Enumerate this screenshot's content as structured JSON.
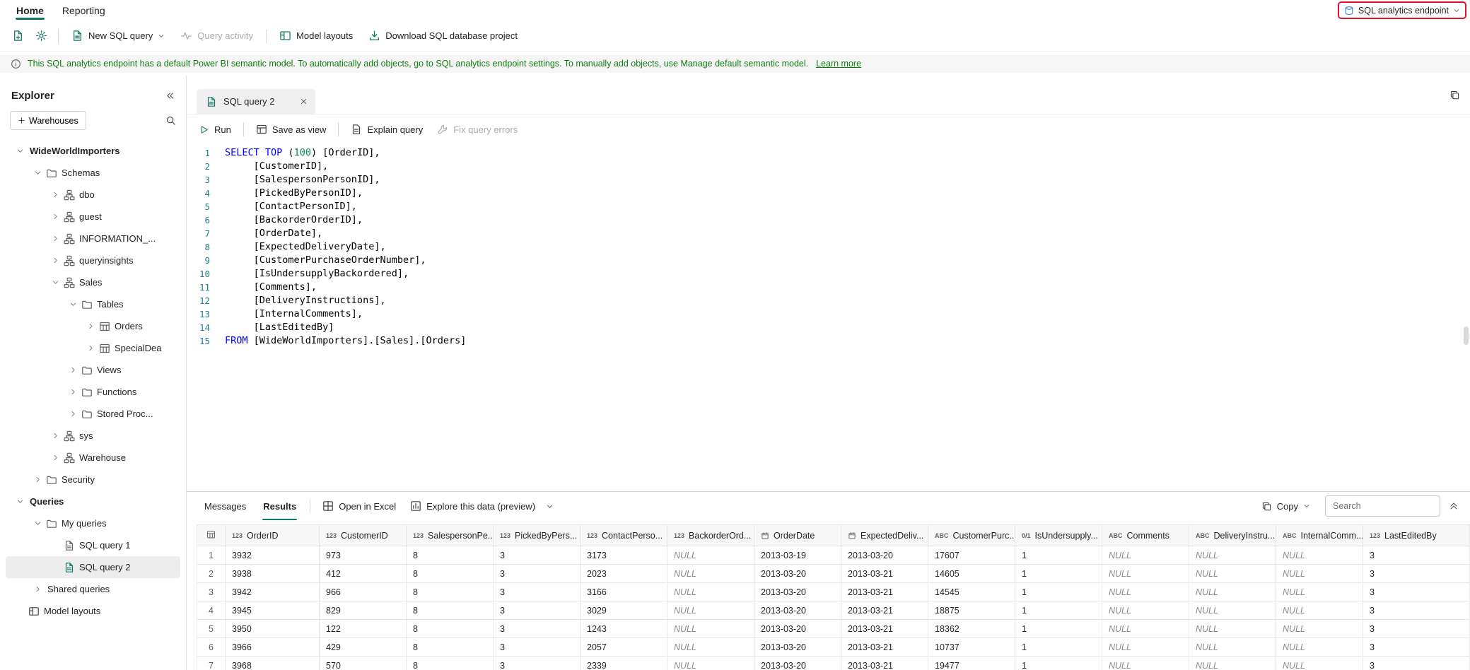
{
  "accent_color": "#117865",
  "highlight_color": "#e8112d",
  "ribbon": {
    "tabs": [
      {
        "label": "Home"
      },
      {
        "label": "Reporting"
      }
    ],
    "endpoint": {
      "label": "SQL analytics endpoint"
    }
  },
  "toolbar": {
    "new_sql_query": "New SQL query",
    "query_activity": "Query activity",
    "model_layouts": "Model layouts",
    "download_project": "Download SQL database project"
  },
  "banner": {
    "text": "This SQL analytics endpoint has a default Power BI semantic model. To automatically add objects, go to SQL analytics endpoint settings. To manually add objects, use Manage default semantic model.",
    "link": "Learn more"
  },
  "explorer": {
    "title": "Explorer",
    "warehouses": "Warehouses",
    "tree": [
      {
        "label": "WideWorldImporters",
        "level": 0,
        "chevron": "down",
        "icon": null,
        "bold": true
      },
      {
        "label": "Schemas",
        "level": 1,
        "chevron": "down",
        "icon": "folder"
      },
      {
        "label": "dbo",
        "level": 2,
        "chevron": "right",
        "icon": "schema"
      },
      {
        "label": "guest",
        "level": 2,
        "chevron": "right",
        "icon": "schema"
      },
      {
        "label": "INFORMATION_...",
        "level": 2,
        "chevron": "right",
        "icon": "schema"
      },
      {
        "label": "queryinsights",
        "level": 2,
        "chevron": "right",
        "icon": "schema"
      },
      {
        "label": "Sales",
        "level": 2,
        "chevron": "down",
        "icon": "schema"
      },
      {
        "label": "Tables",
        "level": 3,
        "chevron": "down",
        "icon": "folder"
      },
      {
        "label": "Orders",
        "level": 4,
        "chevron": "right",
        "icon": "table"
      },
      {
        "label": "SpecialDea",
        "level": 4,
        "chevron": "right",
        "icon": "table"
      },
      {
        "label": "Views",
        "level": 3,
        "chevron": "right",
        "icon": "folder"
      },
      {
        "label": "Functions",
        "level": 3,
        "chevron": "right",
        "icon": "folder"
      },
      {
        "label": "Stored Proc...",
        "level": 3,
        "chevron": "right",
        "icon": "folder"
      },
      {
        "label": "sys",
        "level": 2,
        "chevron": "right",
        "icon": "schema"
      },
      {
        "label": "Warehouse",
        "level": 2,
        "chevron": "right",
        "icon": "schema"
      },
      {
        "label": "Security",
        "level": 1,
        "chevron": "right",
        "icon": "folder"
      },
      {
        "label": "Queries",
        "level": 0,
        "chevron": "down",
        "icon": null,
        "bold": true
      },
      {
        "label": "My queries",
        "level": 1,
        "chevron": "down",
        "icon": "folder"
      },
      {
        "label": "SQL query 1",
        "level": 2,
        "chevron": null,
        "icon": "sql"
      },
      {
        "label": "SQL query 2",
        "level": 2,
        "chevron": null,
        "icon": "sql-active",
        "selected": true
      },
      {
        "label": "Shared queries",
        "level": 1,
        "chevron": "right",
        "icon": null
      },
      {
        "label": "Model layouts",
        "level": 0,
        "chevron": null,
        "icon": "model"
      }
    ]
  },
  "tab": {
    "title": "SQL query 2"
  },
  "query_toolbar": {
    "run": "Run",
    "save_as_view": "Save as view",
    "explain_query": "Explain query",
    "fix_query_errors": "Fix query errors"
  },
  "editor": {
    "lines": [
      [
        [
          "kw",
          "SELECT"
        ],
        [
          "pl",
          " "
        ],
        [
          "kw",
          "TOP"
        ],
        [
          "pl",
          " ("
        ],
        [
          "num",
          "100"
        ],
        [
          "pl",
          ") [OrderID],"
        ]
      ],
      [
        [
          "pl",
          "     [CustomerID],"
        ]
      ],
      [
        [
          "pl",
          "     [SalespersonPersonID],"
        ]
      ],
      [
        [
          "pl",
          "     [PickedByPersonID],"
        ]
      ],
      [
        [
          "pl",
          "     [ContactPersonID],"
        ]
      ],
      [
        [
          "pl",
          "     [BackorderOrderID],"
        ]
      ],
      [
        [
          "pl",
          "     [OrderDate],"
        ]
      ],
      [
        [
          "pl",
          "     [ExpectedDeliveryDate],"
        ]
      ],
      [
        [
          "pl",
          "     [CustomerPurchaseOrderNumber],"
        ]
      ],
      [
        [
          "pl",
          "     [IsUndersupplyBackordered],"
        ]
      ],
      [
        [
          "pl",
          "     [Comments],"
        ]
      ],
      [
        [
          "pl",
          "     [DeliveryInstructions],"
        ]
      ],
      [
        [
          "pl",
          "     [InternalComments],"
        ]
      ],
      [
        [
          "pl",
          "     [LastEditedBy]"
        ]
      ],
      [
        [
          "kw",
          "FROM"
        ],
        [
          "pl",
          " [WideWorldImporters].[Sales].[Orders]"
        ]
      ]
    ]
  },
  "results": {
    "tab_messages": "Messages",
    "tab_results": "Results",
    "open_in_excel": "Open in Excel",
    "explore": "Explore this data (preview)",
    "copy": "Copy",
    "search_placeholder": "Search",
    "grid": {
      "columns": [
        {
          "type": "num",
          "label": "OrderID"
        },
        {
          "type": "num",
          "label": "CustomerID"
        },
        {
          "type": "num",
          "label": "SalespersonPe..."
        },
        {
          "type": "num",
          "label": "PickedByPers..."
        },
        {
          "type": "num",
          "label": "ContactPerso..."
        },
        {
          "type": "num",
          "label": "BackorderOrd..."
        },
        {
          "type": "date",
          "label": "OrderDate"
        },
        {
          "type": "date",
          "label": "ExpectedDeliv..."
        },
        {
          "type": "text",
          "label": "CustomerPurc..."
        },
        {
          "type": "bool",
          "label": "IsUndersupply..."
        },
        {
          "type": "text",
          "label": "Comments"
        },
        {
          "type": "text",
          "label": "DeliveryInstru..."
        },
        {
          "type": "text",
          "label": "InternalComm..."
        },
        {
          "type": "num",
          "label": "LastEditedBy"
        }
      ],
      "rows": [
        [
          "3932",
          "973",
          "8",
          "3",
          "3173",
          "NULL",
          "2013-03-19",
          "2013-03-20",
          "17607",
          "1",
          "NULL",
          "NULL",
          "NULL",
          "3"
        ],
        [
          "3938",
          "412",
          "8",
          "3",
          "2023",
          "NULL",
          "2013-03-20",
          "2013-03-21",
          "14605",
          "1",
          "NULL",
          "NULL",
          "NULL",
          "3"
        ],
        [
          "3942",
          "966",
          "8",
          "3",
          "3166",
          "NULL",
          "2013-03-20",
          "2013-03-21",
          "14545",
          "1",
          "NULL",
          "NULL",
          "NULL",
          "3"
        ],
        [
          "3945",
          "829",
          "8",
          "3",
          "3029",
          "NULL",
          "2013-03-20",
          "2013-03-21",
          "18875",
          "1",
          "NULL",
          "NULL",
          "NULL",
          "3"
        ],
        [
          "3950",
          "122",
          "8",
          "3",
          "1243",
          "NULL",
          "2013-03-20",
          "2013-03-21",
          "18362",
          "1",
          "NULL",
          "NULL",
          "NULL",
          "3"
        ],
        [
          "3966",
          "429",
          "8",
          "3",
          "2057",
          "NULL",
          "2013-03-20",
          "2013-03-21",
          "10737",
          "1",
          "NULL",
          "NULL",
          "NULL",
          "3"
        ],
        [
          "3968",
          "570",
          "8",
          "3",
          "2339",
          "NULL",
          "2013-03-20",
          "2013-03-21",
          "19477",
          "1",
          "NULL",
          "NULL",
          "NULL",
          "3"
        ]
      ]
    }
  }
}
